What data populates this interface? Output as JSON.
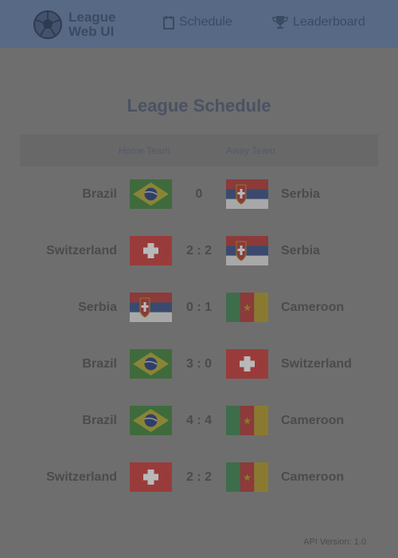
{
  "header": {
    "logo_line1": "League",
    "logo_line2": "Web UI",
    "nav": [
      {
        "label": "Schedule",
        "icon": "calendar-icon"
      },
      {
        "label": "Leaderboard",
        "icon": "trophy-icon"
      }
    ]
  },
  "main": {
    "title": "League Schedule",
    "columns": {
      "home": "Home Team",
      "away": "Away Team"
    },
    "matches": [
      {
        "home": "Brazil",
        "home_flag": "brazil",
        "score": "0",
        "away": "Serbia",
        "away_flag": "serbia"
      },
      {
        "home": "Switzerland",
        "home_flag": "switzerland",
        "score": "2 : 2",
        "away": "Serbia",
        "away_flag": "serbia"
      },
      {
        "home": "Serbia",
        "home_flag": "serbia",
        "score": "0 : 1",
        "away": "Cameroon",
        "away_flag": "cameroon"
      },
      {
        "home": "Brazil",
        "home_flag": "brazil",
        "score": "3 : 0",
        "away": "Switzerland",
        "away_flag": "switzerland"
      },
      {
        "home": "Brazil",
        "home_flag": "brazil",
        "score": "4 : 4",
        "away": "Cameroon",
        "away_flag": "cameroon"
      },
      {
        "home": "Switzerland",
        "home_flag": "switzerland",
        "score": "2 : 2",
        "away": "Cameroon",
        "away_flag": "cameroon"
      }
    ]
  },
  "footer": {
    "api_version": "API Version: 1.0"
  },
  "colors": {
    "header_bg": "#586985",
    "page_bg": "#6e6e6e",
    "brazil_green": "#3f6b3c",
    "swiss_red": "#9a3b3b",
    "cameroon_green": "#3e6d4b",
    "cameroon_red": "#8c3a3a",
    "cameroon_yellow": "#8a7a30"
  }
}
